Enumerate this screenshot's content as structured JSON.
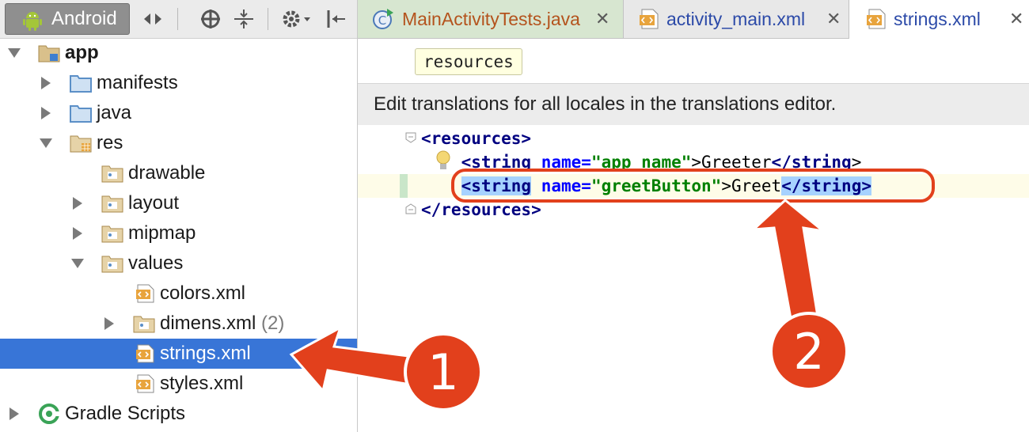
{
  "project_panel": {
    "view_selector": "Android",
    "tree": [
      {
        "label": "app",
        "bold": true,
        "expanded": true,
        "icon": "module-folder-icon"
      },
      {
        "label": "manifests",
        "icon": "folder-icon"
      },
      {
        "label": "java",
        "icon": "folder-icon"
      },
      {
        "label": "res",
        "icon": "res-folder-icon",
        "expanded": true
      },
      {
        "label": "drawable",
        "icon": "folder-icon"
      },
      {
        "label": "layout",
        "icon": "folder-icon"
      },
      {
        "label": "mipmap",
        "icon": "folder-icon"
      },
      {
        "label": "values",
        "icon": "folder-icon",
        "expanded": true
      },
      {
        "label": "colors.xml",
        "icon": "xml-file-icon"
      },
      {
        "label": "dimens.xml",
        "count": "(2)",
        "icon": "folder-icon"
      },
      {
        "label": "strings.xml",
        "icon": "xml-file-icon",
        "selected": true
      },
      {
        "label": "styles.xml",
        "icon": "xml-file-icon"
      },
      {
        "label": "Gradle Scripts",
        "icon": "gradle-icon"
      }
    ]
  },
  "editor": {
    "tabs": [
      {
        "label": "MainActivityTests.java",
        "icon": "java-class-icon",
        "close": "✕"
      },
      {
        "label": "activity_main.xml",
        "icon": "xml-file-icon",
        "close": "✕"
      },
      {
        "label": "strings.xml",
        "icon": "xml-file-icon",
        "close": "✕",
        "active": true
      }
    ],
    "breadcrumb": "resources",
    "notification": "Edit translations for all locales in the translations editor.",
    "code": {
      "l1_open": "<resources>",
      "l2_indent": "    ",
      "l2_tag_open": "<string",
      "l2_attr": " name=",
      "l2_val": "\"app_name\"",
      "l2_text": ">Greeter",
      "l2_tag_close": "</string",
      "l2_end": ">",
      "l3_indent": "    ",
      "l3_tag_open": "<string",
      "l3_attr": " name=",
      "l3_val": "\"greetButton\"",
      "l3_text": ">Greet",
      "l3_tag_close": "</string>",
      "l4_close": "</resources>",
      "l4_end": ">"
    }
  },
  "annotations": {
    "badge_1": "1",
    "badge_2": "2",
    "color": "#e2401c"
  }
}
